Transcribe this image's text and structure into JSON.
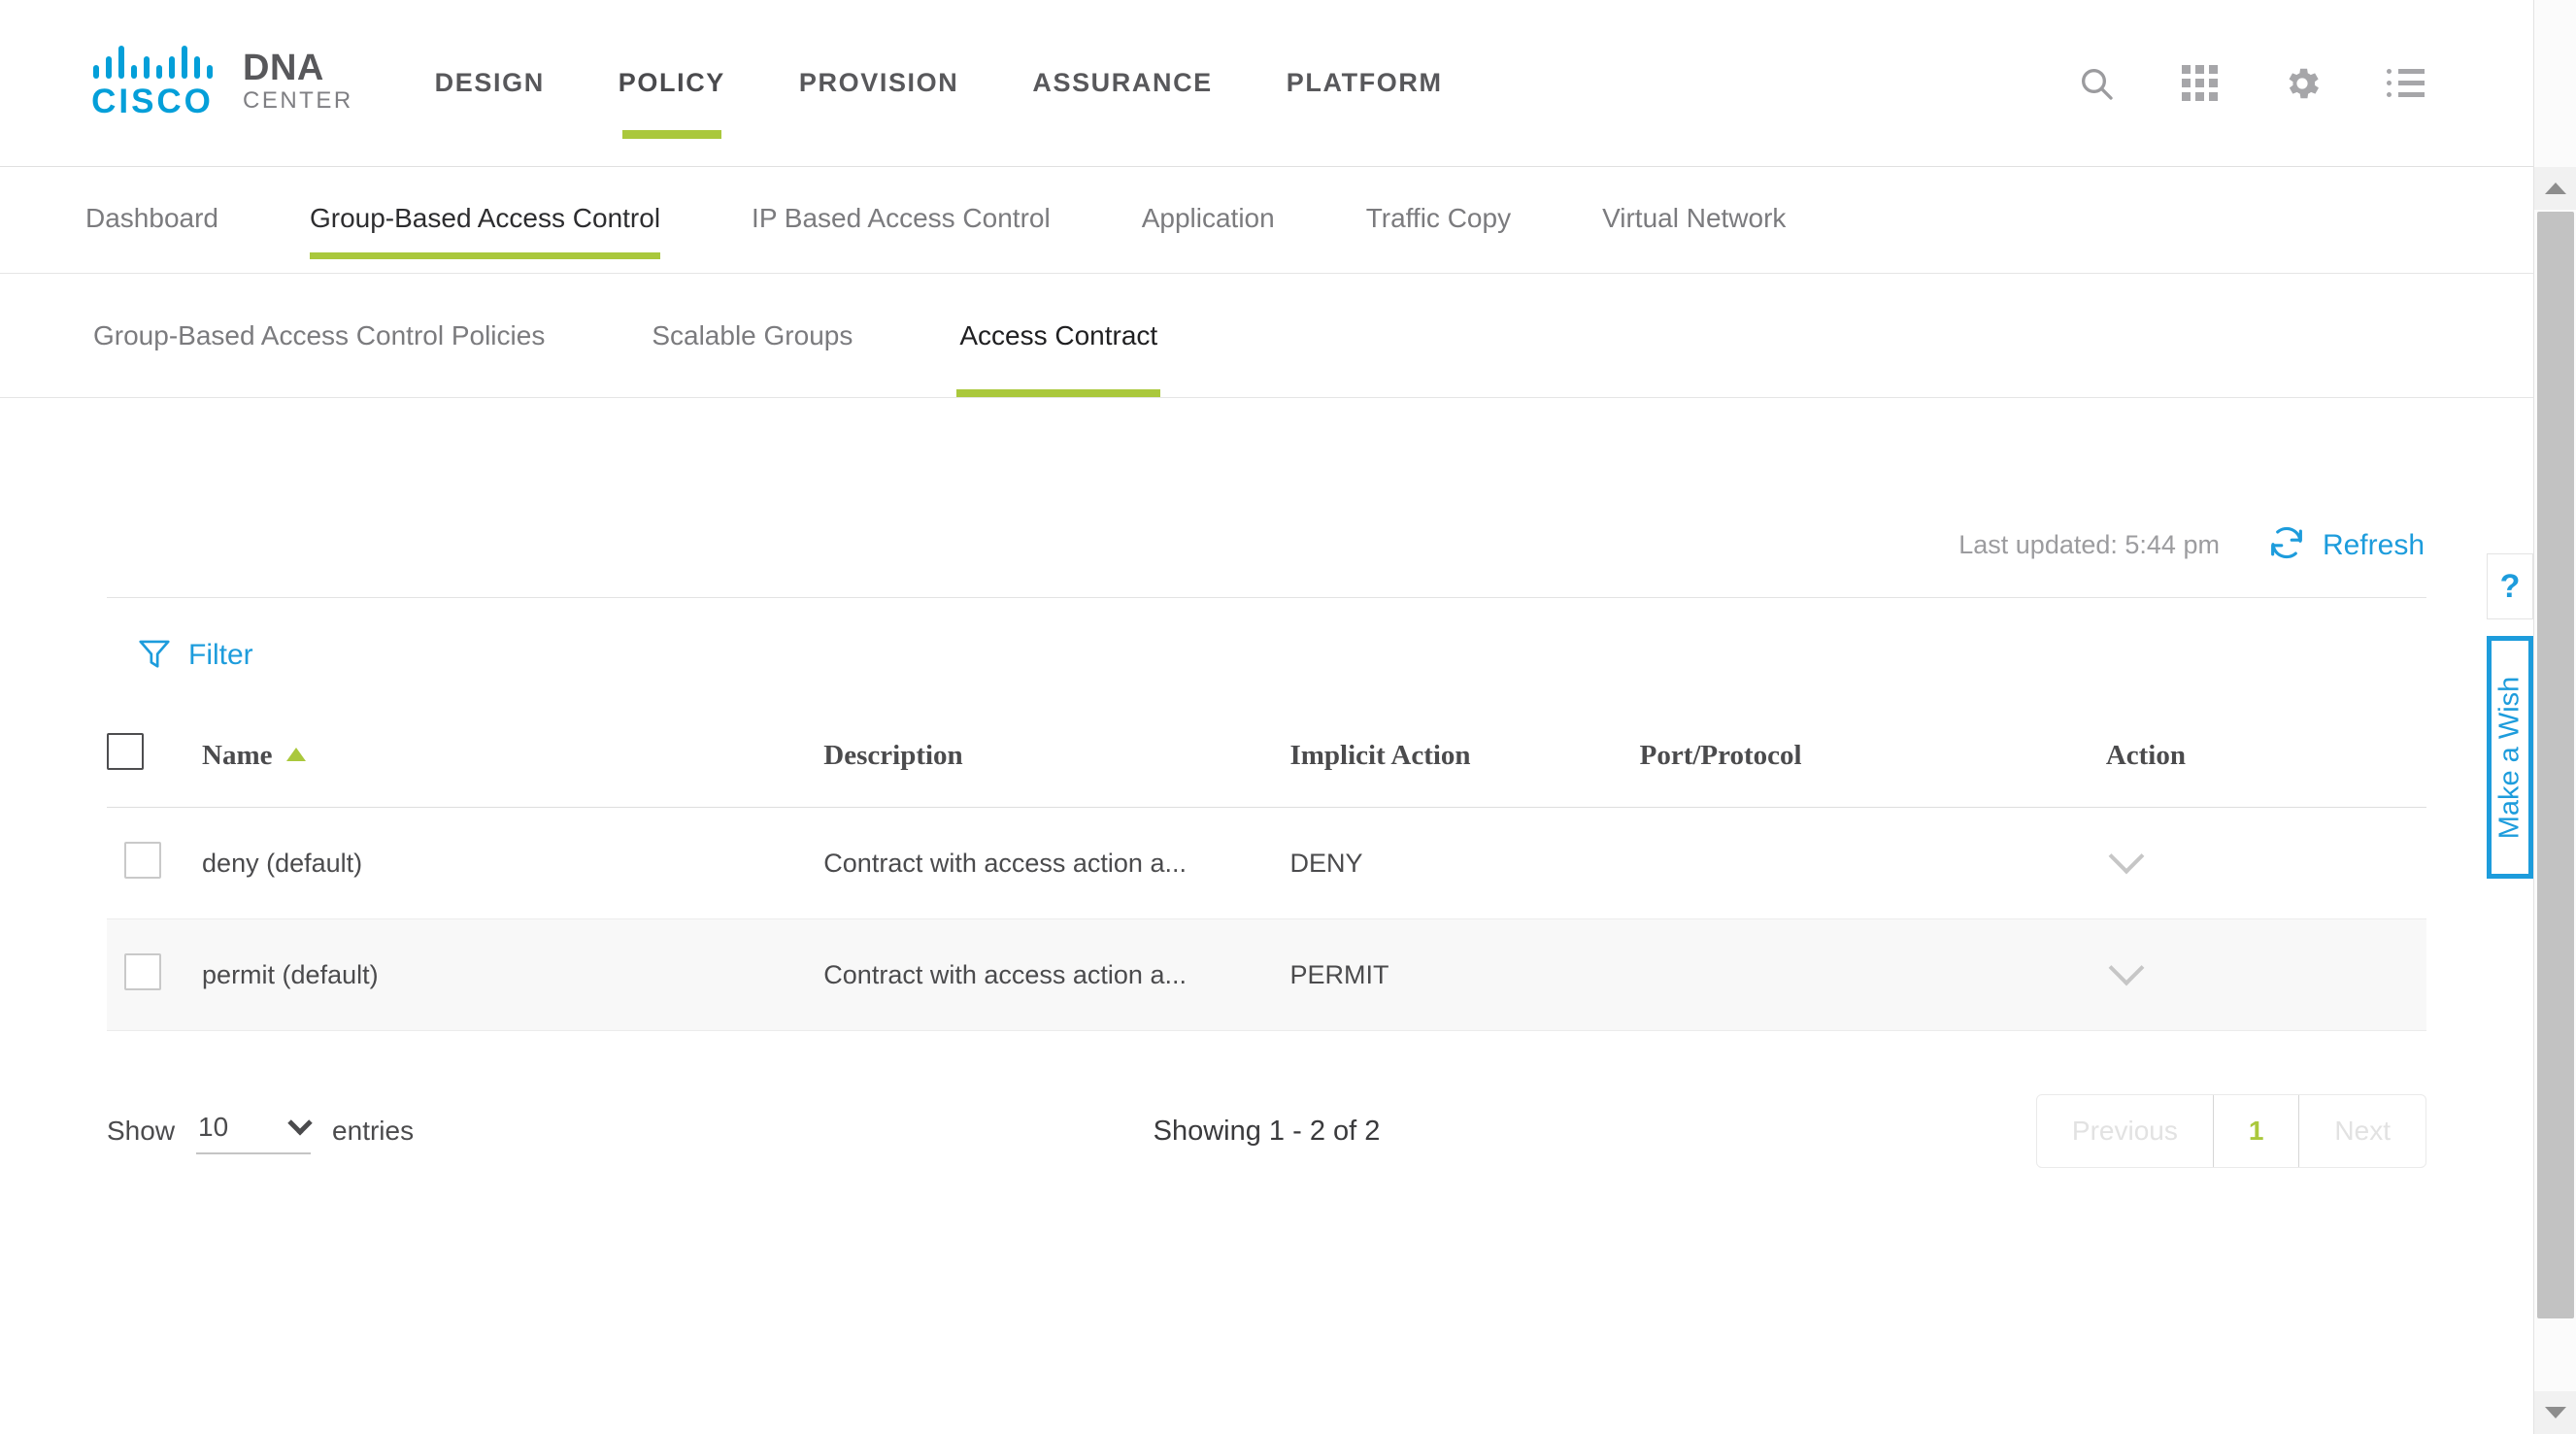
{
  "header": {
    "brand": {
      "logo_icon": "cisco-bars-logo",
      "cisco_text": "CISCO",
      "product_main": "DNA",
      "product_sub": "CENTER"
    },
    "nav": [
      {
        "label": "DESIGN",
        "active": false
      },
      {
        "label": "POLICY",
        "active": true
      },
      {
        "label": "PROVISION",
        "active": false
      },
      {
        "label": "ASSURANCE",
        "active": false
      },
      {
        "label": "PLATFORM",
        "active": false
      }
    ],
    "icons": [
      {
        "name": "search-icon"
      },
      {
        "name": "apps-grid-icon"
      },
      {
        "name": "gear-icon"
      },
      {
        "name": "list-menu-icon"
      }
    ]
  },
  "subnav": [
    {
      "label": "Dashboard",
      "active": false
    },
    {
      "label": "Group-Based Access Control",
      "active": true
    },
    {
      "label": "IP Based Access Control",
      "active": false
    },
    {
      "label": "Application",
      "active": false
    },
    {
      "label": "Traffic Copy",
      "active": false
    },
    {
      "label": "Virtual Network",
      "active": false
    }
  ],
  "tabnav": [
    {
      "label": "Group-Based Access Control Policies",
      "active": false
    },
    {
      "label": "Scalable Groups",
      "active": false
    },
    {
      "label": "Access Contract",
      "active": true
    }
  ],
  "toolbar": {
    "last_updated": "Last updated: 5:44 pm",
    "refresh_label": "Refresh",
    "refresh_icon": "refresh-circular-arrows-icon",
    "filter_label": "Filter",
    "filter_icon": "funnel-icon"
  },
  "table": {
    "columns": [
      "Name",
      "Description",
      "Implicit Action",
      "Port/Protocol",
      "Action"
    ],
    "sort": {
      "column": "Name",
      "direction": "ascending",
      "icon": "sort-ascending-caret-icon"
    },
    "rows": [
      {
        "name": "deny (default)",
        "description": "Contract with access action a...",
        "implicit_action": "DENY",
        "port_protocol": "",
        "action_icon": "chevron-down-icon"
      },
      {
        "name": "permit (default)",
        "description": "Contract with access action a...",
        "implicit_action": "PERMIT",
        "port_protocol": "",
        "action_icon": "chevron-down-icon"
      }
    ]
  },
  "footer": {
    "show_label": "Show",
    "entries_value": "10",
    "entries_label": "entries",
    "showing_text": "Showing 1 - 2 of 2",
    "pagination": {
      "previous": "Previous",
      "page": "1",
      "next": "Next"
    }
  },
  "rail": {
    "help_label": "?",
    "wish_label": "Make a Wish"
  },
  "colors": {
    "accent_green": "#aac83c",
    "link_blue": "#1d9cdc",
    "cisco_blue": "#049fd9",
    "text_dark": "#4b4b4d",
    "text_muted": "#9c9c9f"
  }
}
